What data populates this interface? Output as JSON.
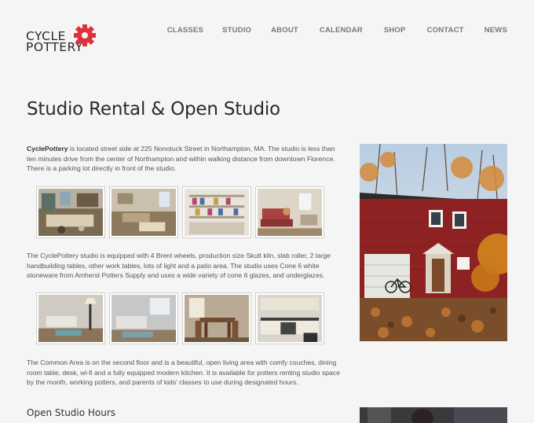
{
  "logo": {
    "line1": "CYCLE",
    "line2": "POTTERY",
    "accent": "#e0303b"
  },
  "nav": [
    "CLASSES",
    "STUDIO",
    "ABOUT",
    "CALENDAR",
    "SHOP",
    "CONTACT",
    "NEWS"
  ],
  "page": {
    "title": "Studio Rental & Open Studio",
    "intro_brand": "CyclePottery",
    "intro_rest": " is located street side at 225 Nonotuck Street in Northampton, MA. The studio is less than ten minutes drive from the center of Northampton and within walking distance from downtown Florence. There is a parking lot directly in front of the studio.",
    "equipment": "The CyclePottery studio is equipped with 4 Brent wheels, production size Skutt kiln, slab roller, 2 large handbuilding tables, other work tables, lots of light and a patio area.  The studio uses Cone 6 white stoneware from Amherst Potters Supply and uses a wide variety of cone 6 glazes, and underglazes.",
    "common_area": "The Common Area is on the second floor and is a beautiful, open living area with comfy couches, dining room table, desk, wi-fi and a fully equipped modern kitchen.  It is available for potters renting studio space by the month, working potters, and parents of kids' classes to use during designated hours.",
    "open_studio_heading": "Open Studio Hours"
  }
}
